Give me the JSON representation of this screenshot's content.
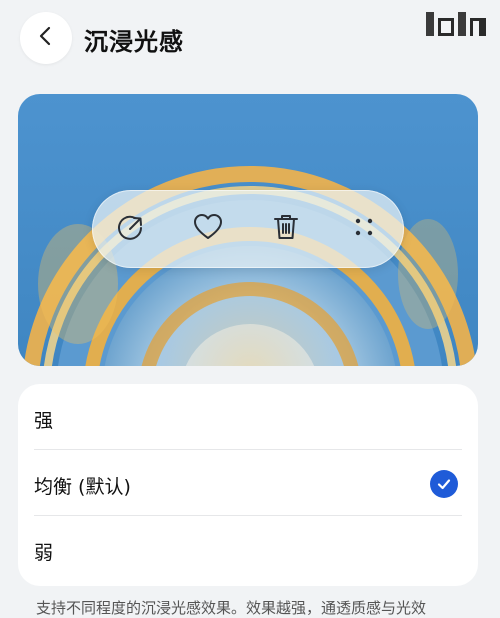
{
  "header": {
    "title": "沉浸光感",
    "back_icon": "chevron-left-icon"
  },
  "preview": {
    "actions": [
      {
        "name": "share-icon",
        "label": "share"
      },
      {
        "name": "heart-icon",
        "label": "favorite"
      },
      {
        "name": "trash-icon",
        "label": "delete"
      },
      {
        "name": "more-dots-icon",
        "label": "more"
      }
    ]
  },
  "options": {
    "items": [
      {
        "label": "强",
        "selected": false
      },
      {
        "label": "均衡 (默认)",
        "selected": true
      },
      {
        "label": "弱",
        "selected": false
      }
    ]
  },
  "description": "支持不同程度的沉浸光感效果。效果越强，通透质感与光效",
  "colors": {
    "accent": "#1f5bd8",
    "background": "#f1f3f5",
    "card": "#ffffff",
    "preview_sky": "#4b8ec8"
  }
}
